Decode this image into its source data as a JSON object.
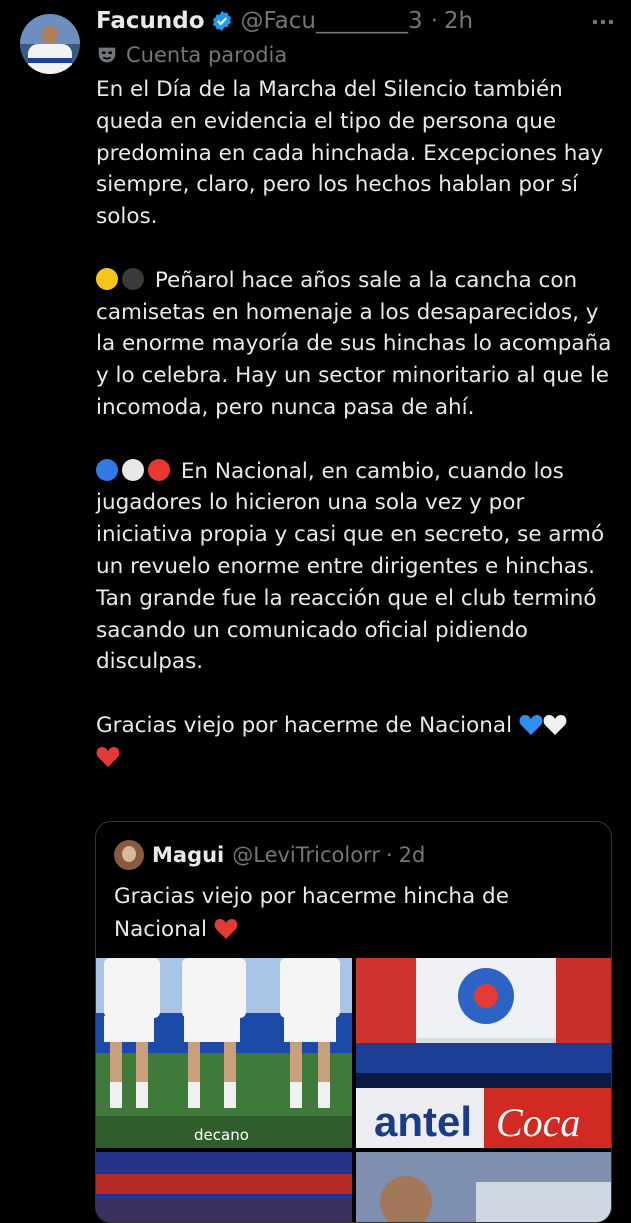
{
  "tweet": {
    "author_name": "Facundo",
    "handle": "@Facu________3",
    "separator": "·",
    "time": "2h",
    "parody_label": "Cuenta parodia",
    "paragraphs": {
      "p1": "En el Día de la Marcha del Silencio también queda en evidencia el tipo de persona que predomina en cada hinchada. Excepciones hay siempre, claro, pero los hechos hablan por sí solos.",
      "p2": "Peñarol hace años sale a la cancha con camisetas en homenaje a los desaparecidos, y la enorme mayoría de sus hinchas lo acompaña y lo celebra. Hay un sector minoritario al que le incomoda, pero nunca pasa de ahí.",
      "p3": "En Nacional, en cambio, cuando los jugadores lo hicieron una sola vez y por iniciativa propia y casi que en secreto, se armó un revuelo enorme entre dirigentes e hinchas. Tan grande fue la reacción que el club terminó sacando un comunicado oficial pidiendo disculpas.",
      "p4": "Gracias viejo por hacerme de Nacional"
    },
    "emoji": {
      "penarol": [
        "yellow-circle",
        "black-circle"
      ],
      "nacional": [
        "blue-circle",
        "white-circle",
        "red-circle"
      ],
      "closing": [
        "blue-heart",
        "white-heart",
        "red-heart"
      ]
    }
  },
  "quoted": {
    "author_name": "Magui",
    "handle": "@LeviTricolorr",
    "separator": "·",
    "time": "2d",
    "text": "Gracias viejo por hacerme hincha de Nacional",
    "emoji": "red-heart",
    "media_watermark": "decano"
  },
  "colors": {
    "background": "#000000",
    "text": "#e7e9ea",
    "secondary": "#71767b",
    "verified": "#1d9bf0",
    "border": "#333639"
  }
}
